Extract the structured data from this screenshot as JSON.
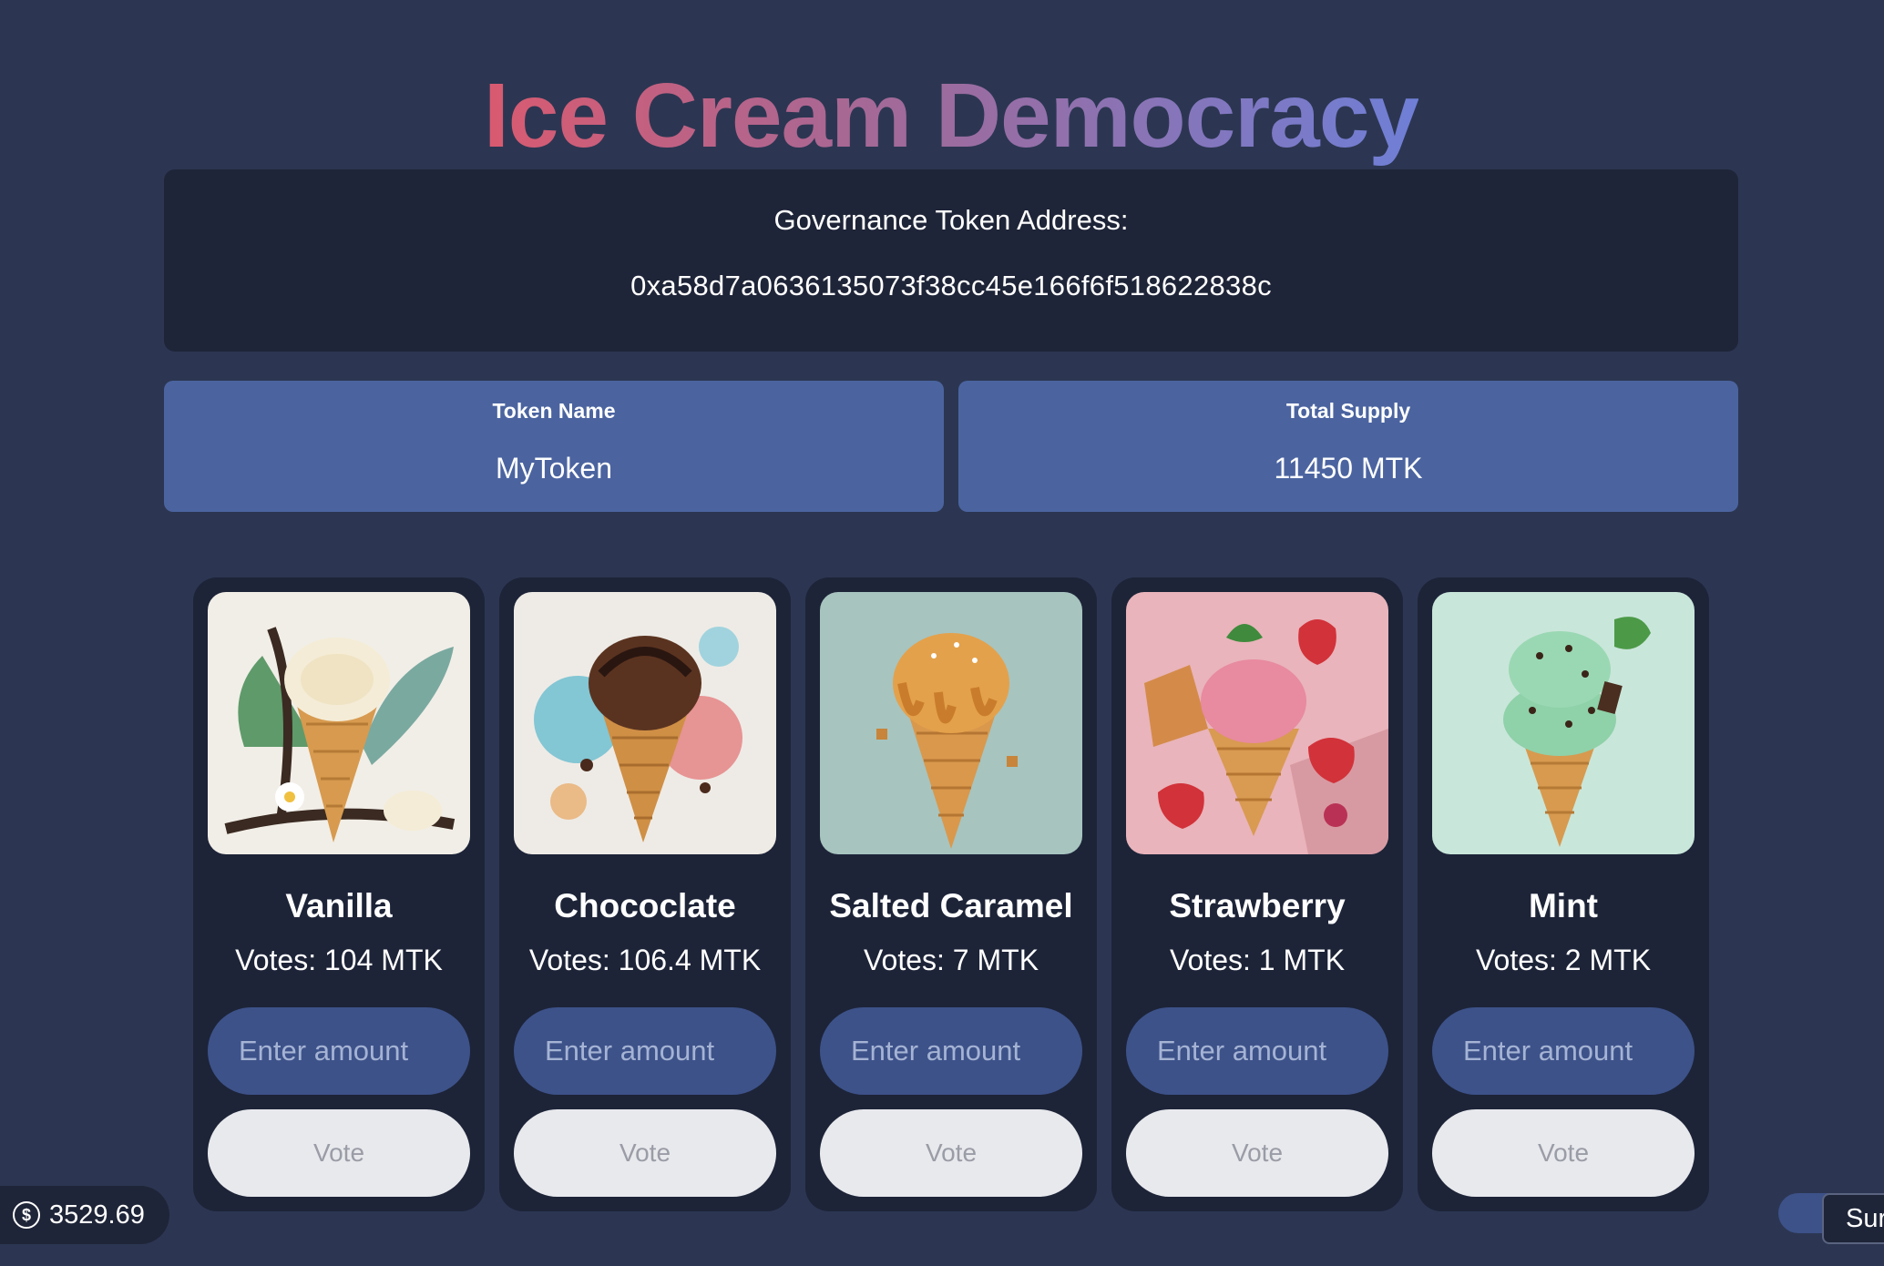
{
  "header": {
    "title": "Ice Cream Democracy"
  },
  "token_address": {
    "label": "Governance Token Address:",
    "value": "0xa58d7a0636135073f38cc45e166f6f518622838c"
  },
  "stats": {
    "token_name_label": "Token Name",
    "token_name_value": "MyToken",
    "total_supply_label": "Total Supply",
    "total_supply_value": "11450 MTK"
  },
  "flavors": [
    {
      "name": "Vanilla",
      "votes": "Votes: 104 MTK",
      "placeholder": "Enter amount",
      "button": "Vote",
      "image": "vanilla-cone-image"
    },
    {
      "name": "Chococlate",
      "votes": "Votes: 106.4 MTK",
      "placeholder": "Enter amount",
      "button": "Vote",
      "image": "chocolate-cone-image"
    },
    {
      "name": "Salted Caramel",
      "votes": "Votes: 7 MTK",
      "placeholder": "Enter amount",
      "button": "Vote",
      "image": "caramel-cone-image"
    },
    {
      "name": "Strawberry",
      "votes": "Votes: 1 MTK",
      "placeholder": "Enter amount",
      "button": "Vote",
      "image": "strawberry-cone-image"
    },
    {
      "name": "Mint",
      "votes": "Votes: 2 MTK",
      "placeholder": "Enter amount",
      "button": "Vote",
      "image": "mint-cone-image"
    }
  ],
  "balance": {
    "icon": "dollar-coin-icon",
    "value": "3529.69"
  },
  "corner_button": {
    "label": "Sur"
  },
  "colors": {
    "background": "#2c3652",
    "panel": "#1f2538",
    "stat_card": "#4b64a0",
    "input": "#3d5289",
    "title_gradient": [
      "#d95a70",
      "#a06a9a",
      "#6f7fd6"
    ]
  }
}
